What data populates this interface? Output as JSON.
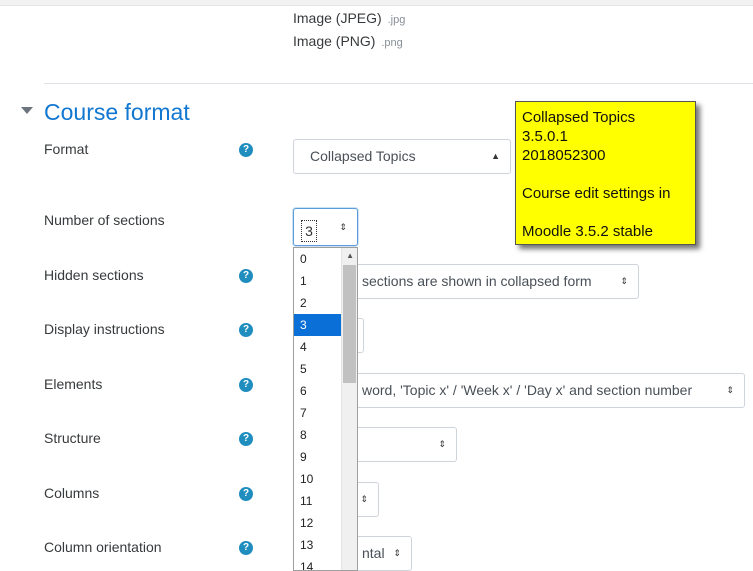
{
  "filetypes": [
    {
      "name": "Image (JPEG)",
      "ext": ".jpg"
    },
    {
      "name": "Image (PNG)",
      "ext": ".png"
    }
  ],
  "section": {
    "title": "Course format"
  },
  "labels": {
    "format": "Format",
    "number_of_sections": "Number of sections",
    "hidden_sections": "Hidden sections",
    "display_instructions": "Display instructions",
    "elements": "Elements",
    "structure": "Structure",
    "columns": "Columns",
    "column_orientation": "Column orientation"
  },
  "help_icon_glyph": "?",
  "format_select": {
    "value": "Collapsed Topics"
  },
  "sections_select": {
    "value": "3"
  },
  "sections_options": [
    "0",
    "1",
    "2",
    "3",
    "4",
    "5",
    "6",
    "7",
    "8",
    "9",
    "10",
    "11",
    "12",
    "13",
    "14"
  ],
  "selected_option": "3",
  "hidden_select": {
    "value": "sections are shown in collapsed form"
  },
  "elements_select": {
    "value": "word, 'Topic x' / 'Week x' / 'Day x' and section number"
  },
  "orientation_select": {
    "value": "ntal"
  },
  "note": {
    "lines": [
      "Collapsed Topics",
      "3.5.0.1",
      "2018052300",
      "",
      "Course edit settings in",
      "",
      "Moodle 3.5.2 stable"
    ]
  },
  "colors": {
    "accent": "#1177d1",
    "help": "#1f8ebf",
    "note_bg": "#ffff00",
    "selected_option_bg": "#0a6fd6"
  }
}
